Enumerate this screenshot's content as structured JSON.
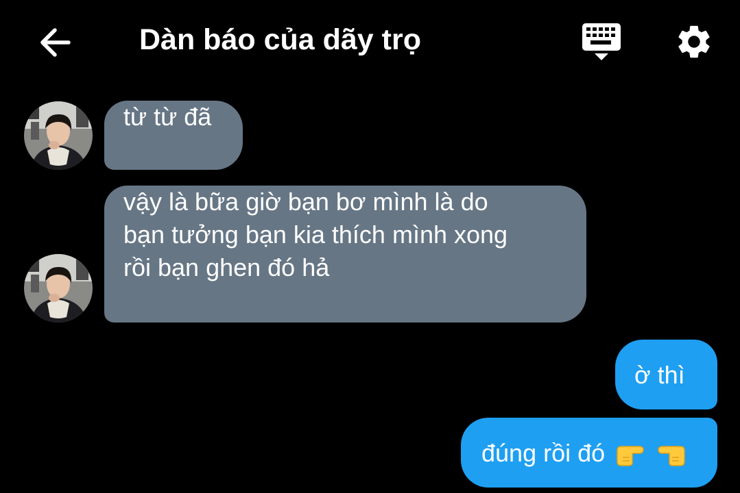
{
  "header": {
    "title": "Dàn báo của dãy trọ",
    "back_icon": "arrow-left-icon",
    "keyboard_icon": "keyboard-icon",
    "settings_icon": "gear-icon"
  },
  "colors": {
    "background": "#000000",
    "incoming_bubble": "#667685",
    "outgoing_bubble": "#1e9ff2",
    "text": "#ffffff"
  },
  "messages": [
    {
      "direction": "incoming",
      "lines": [
        "từ từ đã"
      ]
    },
    {
      "direction": "incoming",
      "lines": [
        "vậy là bữa giờ bạn bơ mình là do",
        "bạn tưởng bạn kia thích mình xong",
        "rồi bạn ghen đó hả"
      ]
    },
    {
      "direction": "outgoing",
      "lines": [
        "ờ thì"
      ]
    },
    {
      "direction": "outgoing",
      "lines": [
        "đúng rồi đó"
      ],
      "emoji": [
        "pointing-right-hand-icon",
        "pointing-left-hand-icon"
      ]
    }
  ]
}
